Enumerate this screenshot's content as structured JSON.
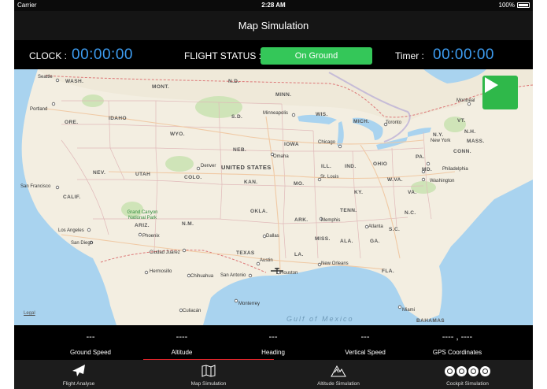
{
  "status_bar": {
    "carrier": "Carrier",
    "time": "2:28 AM",
    "battery": "100%"
  },
  "nav": {
    "title": "Map Simulation"
  },
  "info": {
    "clock_label": "CLOCK :",
    "clock_value": "00:00:00",
    "flight_status_label": "FLIGHT STATUS :",
    "flight_status_value": "On Ground",
    "timer_label": "Timer :",
    "timer_value": "00:00:00"
  },
  "map": {
    "states": [
      "WASH.",
      "MONT.",
      "N.D.",
      "MINN.",
      "ORE.",
      "IDAHO",
      "WYO.",
      "S.D.",
      "WIS.",
      "MICH.",
      "IOWA",
      "NEB.",
      "NEV.",
      "UTAH",
      "COLO.",
      "UNITED STATES",
      "KAN.",
      "MO.",
      "ILL.",
      "IND.",
      "OHIO",
      "PA.",
      "N.Y.",
      "VT.",
      "N.H.",
      "MASS.",
      "CONN.",
      "MD.",
      "W.VA.",
      "VA.",
      "KY.",
      "CALIF.",
      "ARIZ.",
      "N.M.",
      "OKLA.",
      "ARK.",
      "TENN.",
      "N.C.",
      "S.C.",
      "MISS.",
      "ALA.",
      "GA.",
      "TEXAS",
      "LA.",
      "FLA.",
      "BAHAMAS"
    ],
    "cities": [
      "Seattle",
      "Portland",
      "Minneapolis",
      "Chicago",
      "Toronto",
      "Montréal",
      "Omaha",
      "Denver",
      "St. Louis",
      "New York",
      "Philadelphia",
      "Washington",
      "San Francisco",
      "Los Angeles",
      "San Diego",
      "Grand Canyon National Park",
      "Phoenix",
      "Memphis",
      "Atlanta",
      "Dallas",
      "Ciudad Juárez",
      "Austin",
      "New Orleans",
      "Hermosillo",
      "Chihuahua",
      "San Antonio",
      "Houston",
      "Monterrey",
      "Culiacán",
      "Miami"
    ],
    "gulf_label": "Gulf of Mexico",
    "legal": "Legal"
  },
  "stats": [
    {
      "value": "---",
      "label": "Ground Speed"
    },
    {
      "value": "----",
      "label": "Altitude"
    },
    {
      "value": "---",
      "label": "Heading"
    },
    {
      "value": "---",
      "label": "Vertical Speed"
    },
    {
      "value": "---- , ----",
      "label": "GPS Coordinates"
    }
  ],
  "tabs": [
    {
      "label": "Flight Analyse",
      "icon": "airplane-icon"
    },
    {
      "label": "Map Simulation",
      "icon": "map-icon"
    },
    {
      "label": "Altitude Simulation",
      "icon": "mountain-icon"
    },
    {
      "label": "Cockpit Simulation",
      "icon": "gauges-icon"
    }
  ],
  "colors": {
    "accent_blue": "#3d9cf0",
    "status_green": "#34c759",
    "play_green": "#2fb84a",
    "selected_red": "#e0242b"
  }
}
